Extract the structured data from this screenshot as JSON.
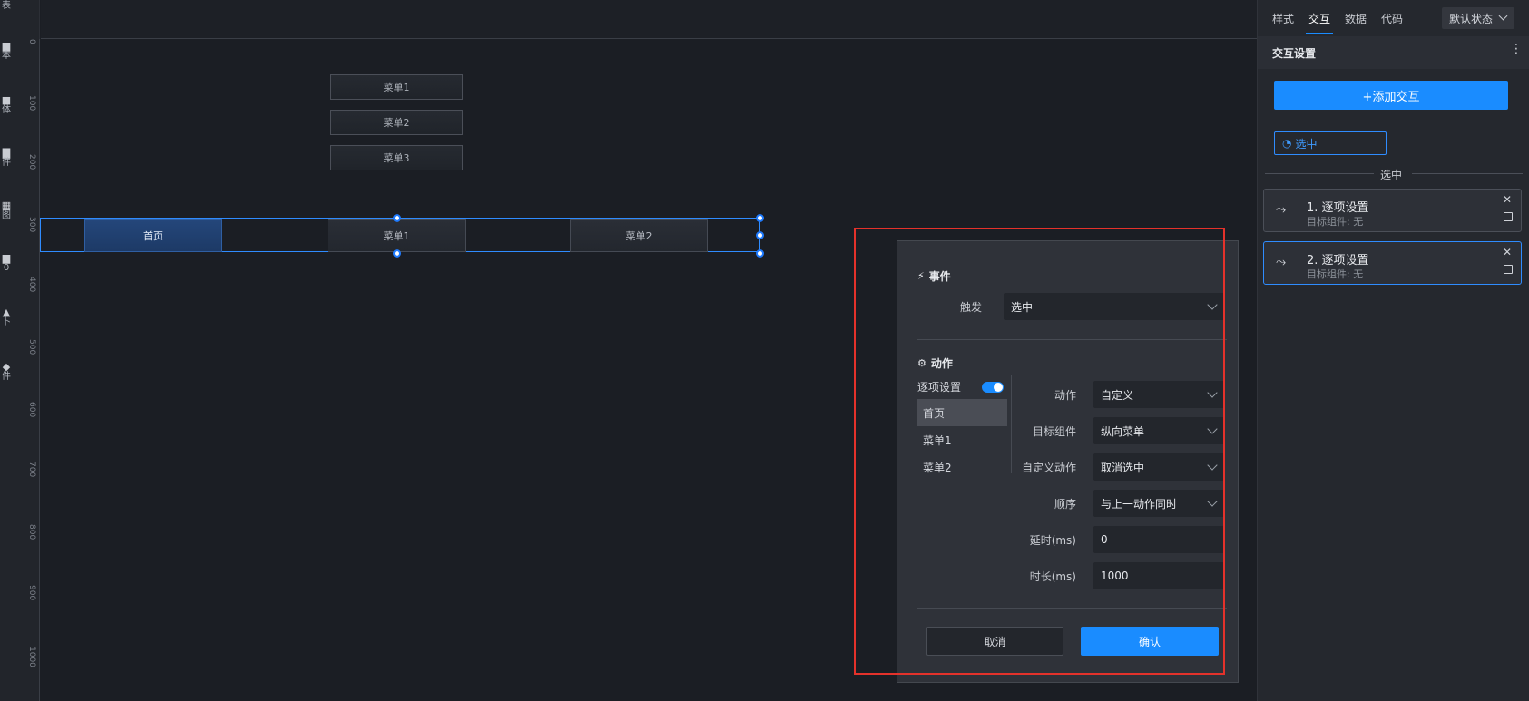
{
  "left_toolbar": {
    "items": [
      {
        "glyph": "",
        "label": "表"
      },
      {
        "glyph": "▆",
        "label": "本"
      },
      {
        "glyph": "■",
        "label": "体"
      },
      {
        "glyph": "▇",
        "label": "件"
      },
      {
        "glyph": "▦",
        "label": "图"
      },
      {
        "glyph": "▆",
        "label": "0"
      },
      {
        "glyph": "▲",
        "label": "卜"
      },
      {
        "glyph": "◆",
        "label": "件"
      }
    ]
  },
  "ruler": {
    "ticks": [
      "0",
      "100",
      "200",
      "300",
      "400",
      "500",
      "600",
      "700",
      "800",
      "900",
      "1000"
    ]
  },
  "canvas": {
    "vertical_menu": [
      "菜单1",
      "菜单2",
      "菜单3"
    ],
    "horizontal_menu": [
      {
        "label": "首页",
        "active": true
      },
      {
        "label": "菜单1",
        "active": false
      },
      {
        "label": "菜单2",
        "active": false
      }
    ]
  },
  "dialog": {
    "event_section": "事件",
    "trigger_label": "触发",
    "trigger_value": "选中",
    "action_section": "动作",
    "itemwise_label": "逐项设置",
    "items": [
      {
        "label": "首页",
        "active": true
      },
      {
        "label": "菜单1",
        "active": false
      },
      {
        "label": "菜单2",
        "active": false
      }
    ],
    "fields": {
      "action_label": "动作",
      "action_value": "自定义",
      "target_label": "目标组件",
      "target_value": "纵向菜单",
      "custom_label": "自定义动作",
      "custom_value": "取消选中",
      "order_label": "顺序",
      "order_value": "与上一动作同时",
      "delay_label": "延时(ms)",
      "delay_value": "0",
      "duration_label": "时长(ms)",
      "duration_value": "1000"
    },
    "cancel_label": "取消",
    "confirm_label": "确认"
  },
  "right_panel": {
    "tabs": [
      {
        "label": "样式",
        "active": false
      },
      {
        "label": "交互",
        "active": true
      },
      {
        "label": "数据",
        "active": false
      },
      {
        "label": "代码",
        "active": false
      }
    ],
    "state_select": "默认状态",
    "section_title": "交互设置",
    "add_button": "+添加交互",
    "chip_label": "选中",
    "group_label": "选中",
    "cards": [
      {
        "title": "1. 逐项设置",
        "subtitle": "目标组件: 无",
        "active": false
      },
      {
        "title": "2. 逐项设置",
        "subtitle": "目标组件: 无",
        "active": true
      }
    ]
  },
  "colors": {
    "accent": "#1a8cff",
    "highlight": "#e4322b",
    "canvas_bg": "#1b1e24",
    "panel_bg": "#25282e"
  }
}
